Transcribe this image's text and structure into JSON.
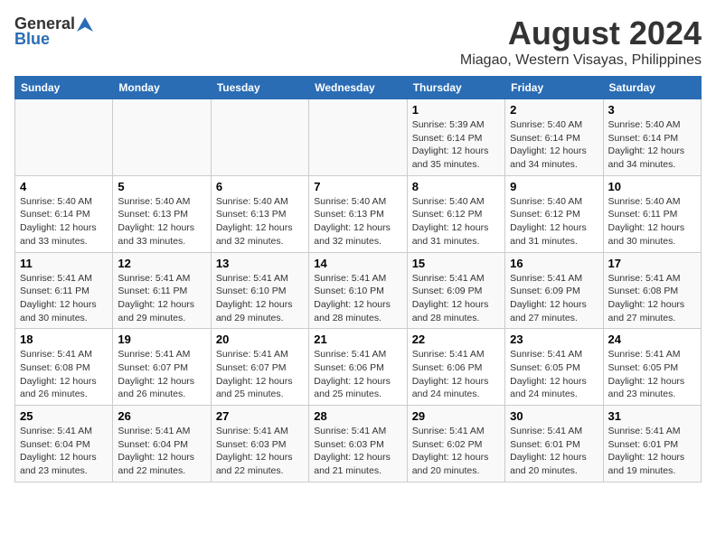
{
  "header": {
    "logo_general": "General",
    "logo_blue": "Blue",
    "title": "August 2024",
    "subtitle": "Miagao, Western Visayas, Philippines"
  },
  "weekdays": [
    "Sunday",
    "Monday",
    "Tuesday",
    "Wednesday",
    "Thursday",
    "Friday",
    "Saturday"
  ],
  "weeks": [
    [
      {
        "day": "",
        "info": ""
      },
      {
        "day": "",
        "info": ""
      },
      {
        "day": "",
        "info": ""
      },
      {
        "day": "",
        "info": ""
      },
      {
        "day": "1",
        "info": "Sunrise: 5:39 AM\nSunset: 6:14 PM\nDaylight: 12 hours\nand 35 minutes."
      },
      {
        "day": "2",
        "info": "Sunrise: 5:40 AM\nSunset: 6:14 PM\nDaylight: 12 hours\nand 34 minutes."
      },
      {
        "day": "3",
        "info": "Sunrise: 5:40 AM\nSunset: 6:14 PM\nDaylight: 12 hours\nand 34 minutes."
      }
    ],
    [
      {
        "day": "4",
        "info": "Sunrise: 5:40 AM\nSunset: 6:14 PM\nDaylight: 12 hours\nand 33 minutes."
      },
      {
        "day": "5",
        "info": "Sunrise: 5:40 AM\nSunset: 6:13 PM\nDaylight: 12 hours\nand 33 minutes."
      },
      {
        "day": "6",
        "info": "Sunrise: 5:40 AM\nSunset: 6:13 PM\nDaylight: 12 hours\nand 32 minutes."
      },
      {
        "day": "7",
        "info": "Sunrise: 5:40 AM\nSunset: 6:13 PM\nDaylight: 12 hours\nand 32 minutes."
      },
      {
        "day": "8",
        "info": "Sunrise: 5:40 AM\nSunset: 6:12 PM\nDaylight: 12 hours\nand 31 minutes."
      },
      {
        "day": "9",
        "info": "Sunrise: 5:40 AM\nSunset: 6:12 PM\nDaylight: 12 hours\nand 31 minutes."
      },
      {
        "day": "10",
        "info": "Sunrise: 5:40 AM\nSunset: 6:11 PM\nDaylight: 12 hours\nand 30 minutes."
      }
    ],
    [
      {
        "day": "11",
        "info": "Sunrise: 5:41 AM\nSunset: 6:11 PM\nDaylight: 12 hours\nand 30 minutes."
      },
      {
        "day": "12",
        "info": "Sunrise: 5:41 AM\nSunset: 6:11 PM\nDaylight: 12 hours\nand 29 minutes."
      },
      {
        "day": "13",
        "info": "Sunrise: 5:41 AM\nSunset: 6:10 PM\nDaylight: 12 hours\nand 29 minutes."
      },
      {
        "day": "14",
        "info": "Sunrise: 5:41 AM\nSunset: 6:10 PM\nDaylight: 12 hours\nand 28 minutes."
      },
      {
        "day": "15",
        "info": "Sunrise: 5:41 AM\nSunset: 6:09 PM\nDaylight: 12 hours\nand 28 minutes."
      },
      {
        "day": "16",
        "info": "Sunrise: 5:41 AM\nSunset: 6:09 PM\nDaylight: 12 hours\nand 27 minutes."
      },
      {
        "day": "17",
        "info": "Sunrise: 5:41 AM\nSunset: 6:08 PM\nDaylight: 12 hours\nand 27 minutes."
      }
    ],
    [
      {
        "day": "18",
        "info": "Sunrise: 5:41 AM\nSunset: 6:08 PM\nDaylight: 12 hours\nand 26 minutes."
      },
      {
        "day": "19",
        "info": "Sunrise: 5:41 AM\nSunset: 6:07 PM\nDaylight: 12 hours\nand 26 minutes."
      },
      {
        "day": "20",
        "info": "Sunrise: 5:41 AM\nSunset: 6:07 PM\nDaylight: 12 hours\nand 25 minutes."
      },
      {
        "day": "21",
        "info": "Sunrise: 5:41 AM\nSunset: 6:06 PM\nDaylight: 12 hours\nand 25 minutes."
      },
      {
        "day": "22",
        "info": "Sunrise: 5:41 AM\nSunset: 6:06 PM\nDaylight: 12 hours\nand 24 minutes."
      },
      {
        "day": "23",
        "info": "Sunrise: 5:41 AM\nSunset: 6:05 PM\nDaylight: 12 hours\nand 24 minutes."
      },
      {
        "day": "24",
        "info": "Sunrise: 5:41 AM\nSunset: 6:05 PM\nDaylight: 12 hours\nand 23 minutes."
      }
    ],
    [
      {
        "day": "25",
        "info": "Sunrise: 5:41 AM\nSunset: 6:04 PM\nDaylight: 12 hours\nand 23 minutes."
      },
      {
        "day": "26",
        "info": "Sunrise: 5:41 AM\nSunset: 6:04 PM\nDaylight: 12 hours\nand 22 minutes."
      },
      {
        "day": "27",
        "info": "Sunrise: 5:41 AM\nSunset: 6:03 PM\nDaylight: 12 hours\nand 22 minutes."
      },
      {
        "day": "28",
        "info": "Sunrise: 5:41 AM\nSunset: 6:03 PM\nDaylight: 12 hours\nand 21 minutes."
      },
      {
        "day": "29",
        "info": "Sunrise: 5:41 AM\nSunset: 6:02 PM\nDaylight: 12 hours\nand 20 minutes."
      },
      {
        "day": "30",
        "info": "Sunrise: 5:41 AM\nSunset: 6:01 PM\nDaylight: 12 hours\nand 20 minutes."
      },
      {
        "day": "31",
        "info": "Sunrise: 5:41 AM\nSunset: 6:01 PM\nDaylight: 12 hours\nand 19 minutes."
      }
    ]
  ]
}
